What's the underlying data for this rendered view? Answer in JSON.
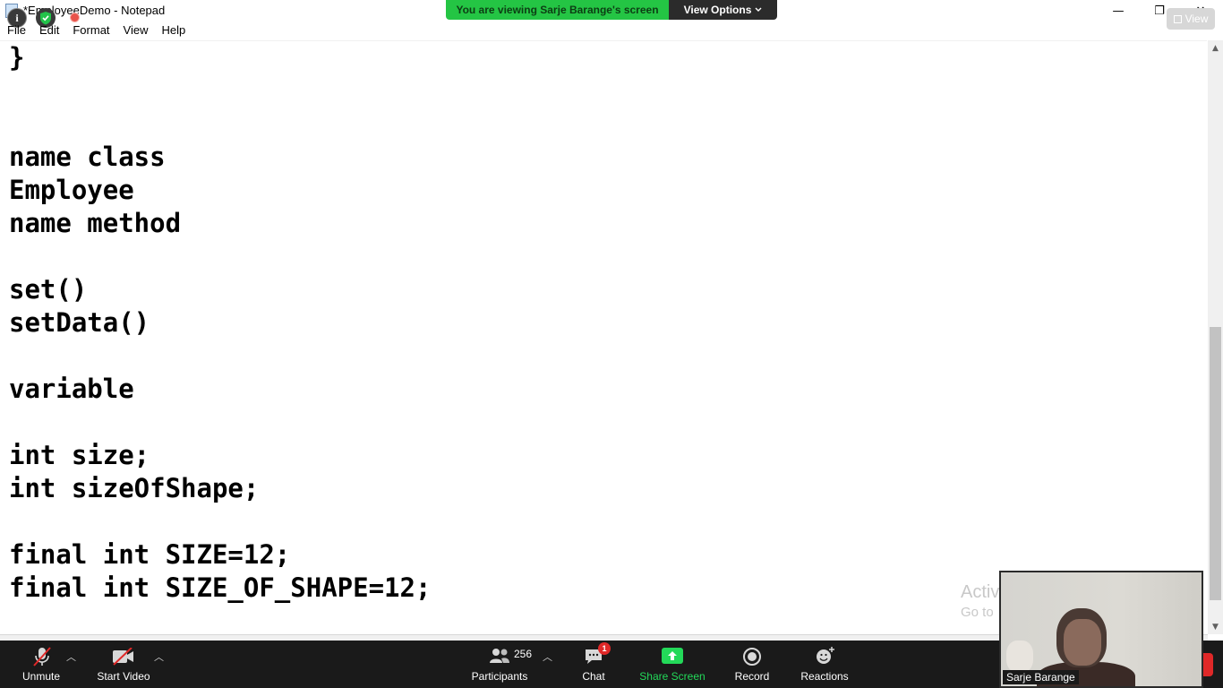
{
  "window": {
    "title": "*EmployeeDemo - Notepad",
    "minimize_glyph": "—",
    "maximize_glyph": "❐",
    "close_glyph": "✕"
  },
  "menu": [
    "File",
    "Edit",
    "Format",
    "View",
    "Help"
  ],
  "banner": {
    "viewing_text": "You are viewing Sarje Barange's screen",
    "view_options_label": "View Options"
  },
  "view_button_label": "View",
  "editor": {
    "lines": [
      "}",
      "",
      "",
      "name class",
      "Employee",
      "name method",
      "",
      "set()",
      "setData()",
      "",
      "variable",
      "",
      "int size;",
      "int sizeOfShape;",
      "",
      "final int SIZE=12;",
      "final int SIZE_OF_SHAPE=12;"
    ]
  },
  "watermark": {
    "line1": "Activ",
    "line2": "Go to"
  },
  "toolbar": {
    "unmute_label": "Unmute",
    "start_video_label": "Start Video",
    "participants_label": "Participants",
    "participants_count": "256",
    "chat_label": "Chat",
    "chat_badge": "1",
    "share_screen_label": "Share Screen",
    "record_label": "Record",
    "reactions_label": "Reactions"
  },
  "video": {
    "participant_name": "Sarje Barange"
  },
  "colors": {
    "banner_green": "#24c544",
    "share_green": "#23d959",
    "badge_red": "#e02828",
    "toolbar_bg": "#1a1a1a"
  }
}
